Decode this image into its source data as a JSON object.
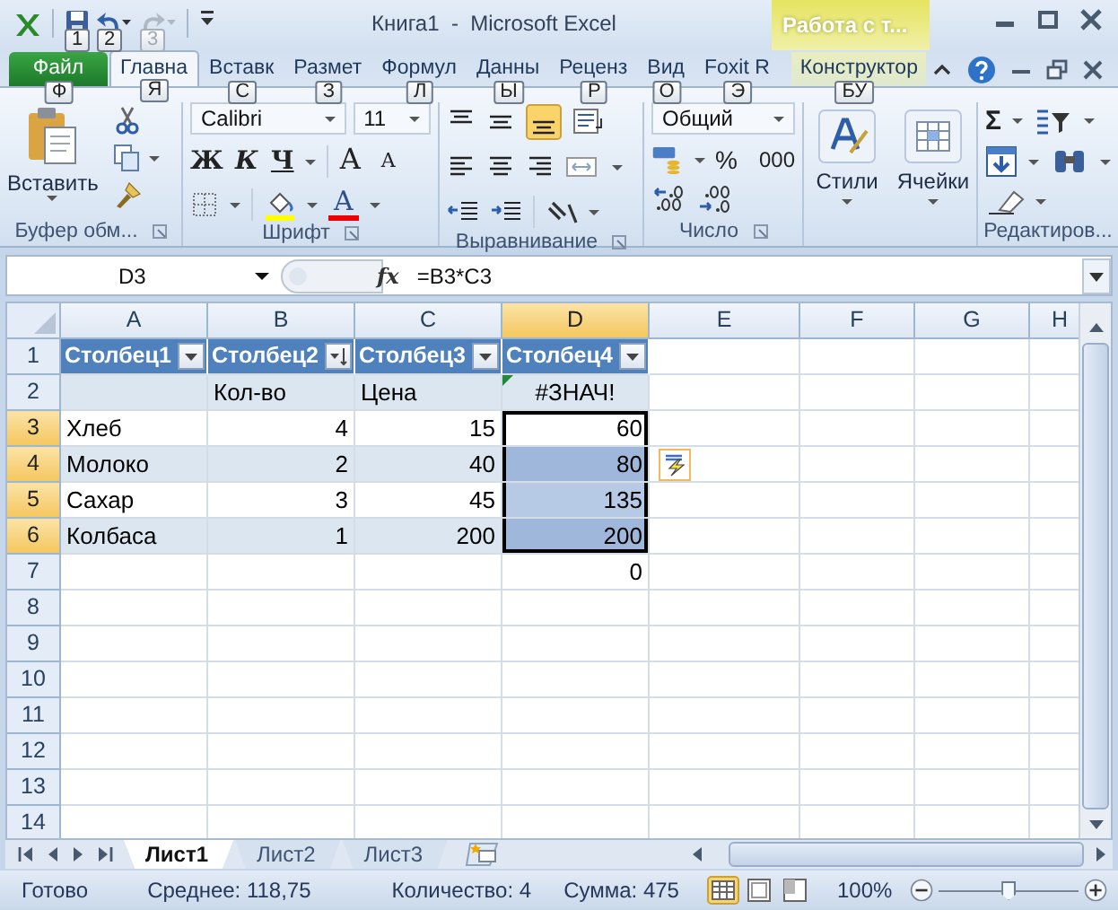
{
  "title": "Книга1  -  Microsoft Excel",
  "contextual_tab": "Работа с т...",
  "quick_access": [
    {
      "kind": "save",
      "keytip": "1",
      "disabled": false
    },
    {
      "kind": "undo",
      "keytip": "2",
      "disabled": false
    },
    {
      "kind": "redo",
      "keytip": "3",
      "disabled": true
    }
  ],
  "tabs": [
    {
      "label": "Файл",
      "keytip": "Ф",
      "kind": "file",
      "selected": false
    },
    {
      "label": "Главна",
      "keytip": "Я",
      "kind": "normal",
      "selected": true
    },
    {
      "label": "Вставк",
      "keytip": "С",
      "kind": "normal",
      "selected": false
    },
    {
      "label": "Размет",
      "keytip": "З",
      "kind": "normal",
      "selected": false
    },
    {
      "label": "Формул",
      "keytip": "Л",
      "kind": "normal",
      "selected": false
    },
    {
      "label": "Данны",
      "keytip": "Ы",
      "kind": "normal",
      "selected": false
    },
    {
      "label": "Реценз",
      "keytip": "Р",
      "kind": "normal",
      "selected": false
    },
    {
      "label": "Вид",
      "keytip": "О",
      "kind": "normal",
      "selected": false
    },
    {
      "label": "Foxit R",
      "keytip": "Э",
      "kind": "normal",
      "selected": false
    },
    {
      "label": "Конструктор",
      "keytip": "БУ",
      "kind": "contextual",
      "selected": false
    }
  ],
  "ribbon": {
    "clipboard": {
      "label": "Буфер обм...",
      "paste": "Вставить"
    },
    "font": {
      "label": "Шрифт",
      "name": "Calibri",
      "size": "11",
      "bold": "Ж",
      "italic": "К",
      "underline": "Ч",
      "grow": "A",
      "shrink": "A",
      "font_color_button": "A"
    },
    "alignment": {
      "label": "Выравнивание"
    },
    "number": {
      "label": "Число",
      "format": "Общий",
      "percent": "%",
      "thousands": "000"
    },
    "styles": {
      "button": "Стили"
    },
    "cells": {
      "button": "Ячейки"
    },
    "editing": {
      "label": "Редактиров...",
      "autosum": "Σ"
    }
  },
  "name_box": "D3",
  "insert_function": "fx",
  "formula": "=B3*C3",
  "columns": [
    {
      "label": "A",
      "selected": false
    },
    {
      "label": "B",
      "selected": false
    },
    {
      "label": "C",
      "selected": false
    },
    {
      "label": "D",
      "selected": true
    },
    {
      "label": "E",
      "selected": false
    },
    {
      "label": "F",
      "selected": false
    },
    {
      "label": "G",
      "selected": false
    },
    {
      "label": "H",
      "selected": false
    }
  ],
  "rows": [
    {
      "number": "1",
      "selected": false,
      "cells": [
        {
          "text": "Столбец1",
          "kind": "header",
          "sorted": false,
          "selected": false
        },
        {
          "text": "Столбец2",
          "kind": "header",
          "sorted": true,
          "selected": false
        },
        {
          "text": "Столбец3",
          "kind": "header",
          "sorted": false,
          "selected": false
        },
        {
          "text": "Столбец4",
          "kind": "header",
          "sorted": false,
          "selected": false
        }
      ]
    },
    {
      "number": "2",
      "selected": false,
      "cells": [
        {
          "kind": "empty",
          "selected": false
        },
        {
          "text": "Кол-во",
          "kind": "text",
          "selected": false
        },
        {
          "text": "Цена",
          "kind": "text",
          "selected": false
        },
        {
          "text": "#ЗНАЧ!",
          "kind": "error",
          "selected": false
        }
      ]
    },
    {
      "number": "3",
      "selected": true,
      "cells": [
        {
          "text": "Хлеб",
          "kind": "text",
          "selected": false
        },
        {
          "text": "4",
          "kind": "number",
          "selected": false
        },
        {
          "text": "15",
          "kind": "number",
          "selected": false
        },
        {
          "text": "60",
          "kind": "number",
          "selected": true
        }
      ]
    },
    {
      "number": "4",
      "selected": true,
      "cells": [
        {
          "text": "Молоко",
          "kind": "text",
          "selected": false
        },
        {
          "text": "2",
          "kind": "number",
          "selected": false
        },
        {
          "text": "40",
          "kind": "number",
          "selected": false
        },
        {
          "text": "80",
          "kind": "number",
          "selected": true
        }
      ]
    },
    {
      "number": "5",
      "selected": true,
      "cells": [
        {
          "text": "Сахар",
          "kind": "text",
          "selected": false
        },
        {
          "text": "3",
          "kind": "number",
          "selected": false
        },
        {
          "text": "45",
          "kind": "number",
          "selected": false
        },
        {
          "text": "135",
          "kind": "number",
          "selected": true
        }
      ]
    },
    {
      "number": "6",
      "selected": true,
      "cells": [
        {
          "text": "Колбаса",
          "kind": "text",
          "selected": false
        },
        {
          "text": "1",
          "kind": "number",
          "selected": false
        },
        {
          "text": "200",
          "kind": "number",
          "selected": false
        },
        {
          "text": "200",
          "kind": "number",
          "selected": true
        }
      ]
    },
    {
      "number": "7",
      "selected": false,
      "cells": [
        {
          "kind": "empty"
        },
        {
          "kind": "empty"
        },
        {
          "kind": "empty"
        },
        {
          "text": "0",
          "kind": "number",
          "selected": false
        }
      ]
    },
    {
      "number": "8",
      "selected": false,
      "cells": []
    },
    {
      "number": "9",
      "selected": false,
      "cells": []
    },
    {
      "number": "10",
      "selected": false,
      "cells": []
    },
    {
      "number": "11",
      "selected": false,
      "cells": []
    },
    {
      "number": "12",
      "selected": false,
      "cells": []
    },
    {
      "number": "13",
      "selected": false,
      "cells": []
    },
    {
      "number": "14",
      "selected": false,
      "cells": []
    }
  ],
  "sheets": [
    {
      "label": "Лист1",
      "selected": true
    },
    {
      "label": "Лист2",
      "selected": false
    },
    {
      "label": "Лист3",
      "selected": false
    }
  ],
  "status_bar": {
    "state": "Готово",
    "average": "Среднее: 118,75",
    "count": "Количество: 4",
    "sum": "Сумма: 475",
    "views": [
      {
        "kind": "normal",
        "selected": true
      },
      {
        "kind": "layout",
        "selected": false
      },
      {
        "kind": "pagebreak",
        "selected": false
      }
    ],
    "zoom": "100%",
    "zoom_slider": {
      "level": 0.5
    }
  }
}
